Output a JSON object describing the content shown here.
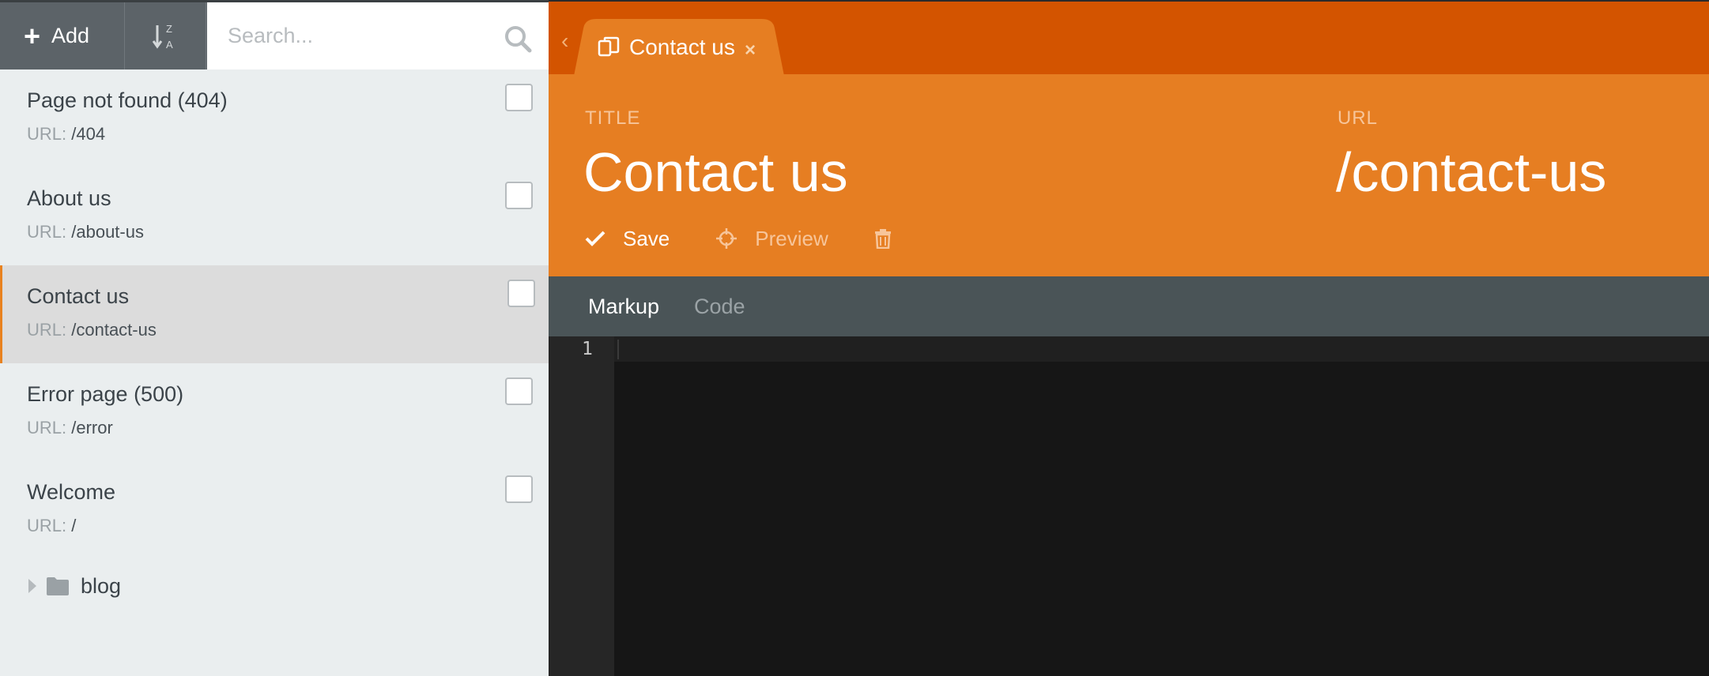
{
  "sidebar": {
    "add_label": "Add",
    "sort_glyph_top": "Z",
    "sort_glyph_bottom": "A",
    "search": {
      "placeholder": "Search...",
      "value": ""
    },
    "url_prefix": "URL:",
    "pages": [
      {
        "title": "Page not found (404)",
        "url": "/404",
        "active": false
      },
      {
        "title": "About us",
        "url": "/about-us",
        "active": false
      },
      {
        "title": "Contact us",
        "url": "/contact-us",
        "active": true
      },
      {
        "title": "Error page (500)",
        "url": "/error",
        "active": false
      },
      {
        "title": "Welcome",
        "url": "/",
        "active": false
      }
    ],
    "folder": {
      "label": "blog"
    }
  },
  "main": {
    "tab": {
      "label": "Contact us",
      "close": "×"
    },
    "back": "‹",
    "header": {
      "title_label": "TITLE",
      "title_value": "Contact us",
      "url_label": "URL",
      "url_value": "/contact-us"
    },
    "actions": {
      "save": "Save",
      "preview": "Preview"
    },
    "editor_tabs": {
      "markup": "Markup",
      "code": "Code"
    },
    "editor": {
      "line_number": "1"
    }
  },
  "colors": {
    "accent_dark": "#d35400",
    "accent": "#e67e22",
    "sidebar_bg": "#eaeeef",
    "toolbar_bg": "#5c6368",
    "editor_bg": "#161616"
  },
  "icons": [
    "plus-icon",
    "sort-za-icon",
    "search-icon",
    "checkbox",
    "caret-right-icon",
    "folder-icon",
    "chevron-left-icon",
    "pages-icon",
    "close-icon",
    "check-icon",
    "crosshair-icon",
    "trash-icon"
  ]
}
